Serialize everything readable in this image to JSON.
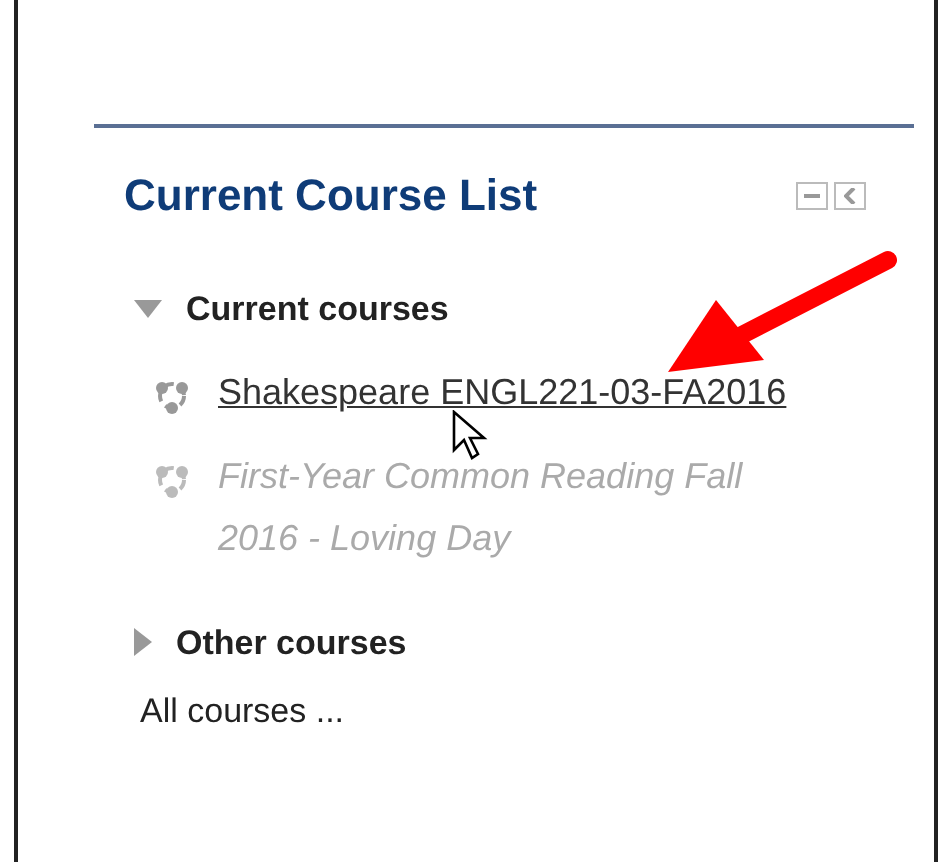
{
  "block": {
    "title": "Current Course List",
    "categories": [
      {
        "label": "Current courses",
        "expanded": true,
        "courses": [
          {
            "name": "Shakespeare ENGL221-03-FA2016",
            "dimmed": false,
            "hovered": true
          },
          {
            "name": "First-Year Common Reading Fall 2016 - Loving Day",
            "dimmed": true,
            "hovered": false
          }
        ]
      },
      {
        "label": "Other courses",
        "expanded": false
      }
    ],
    "footer_link": "All courses ..."
  }
}
